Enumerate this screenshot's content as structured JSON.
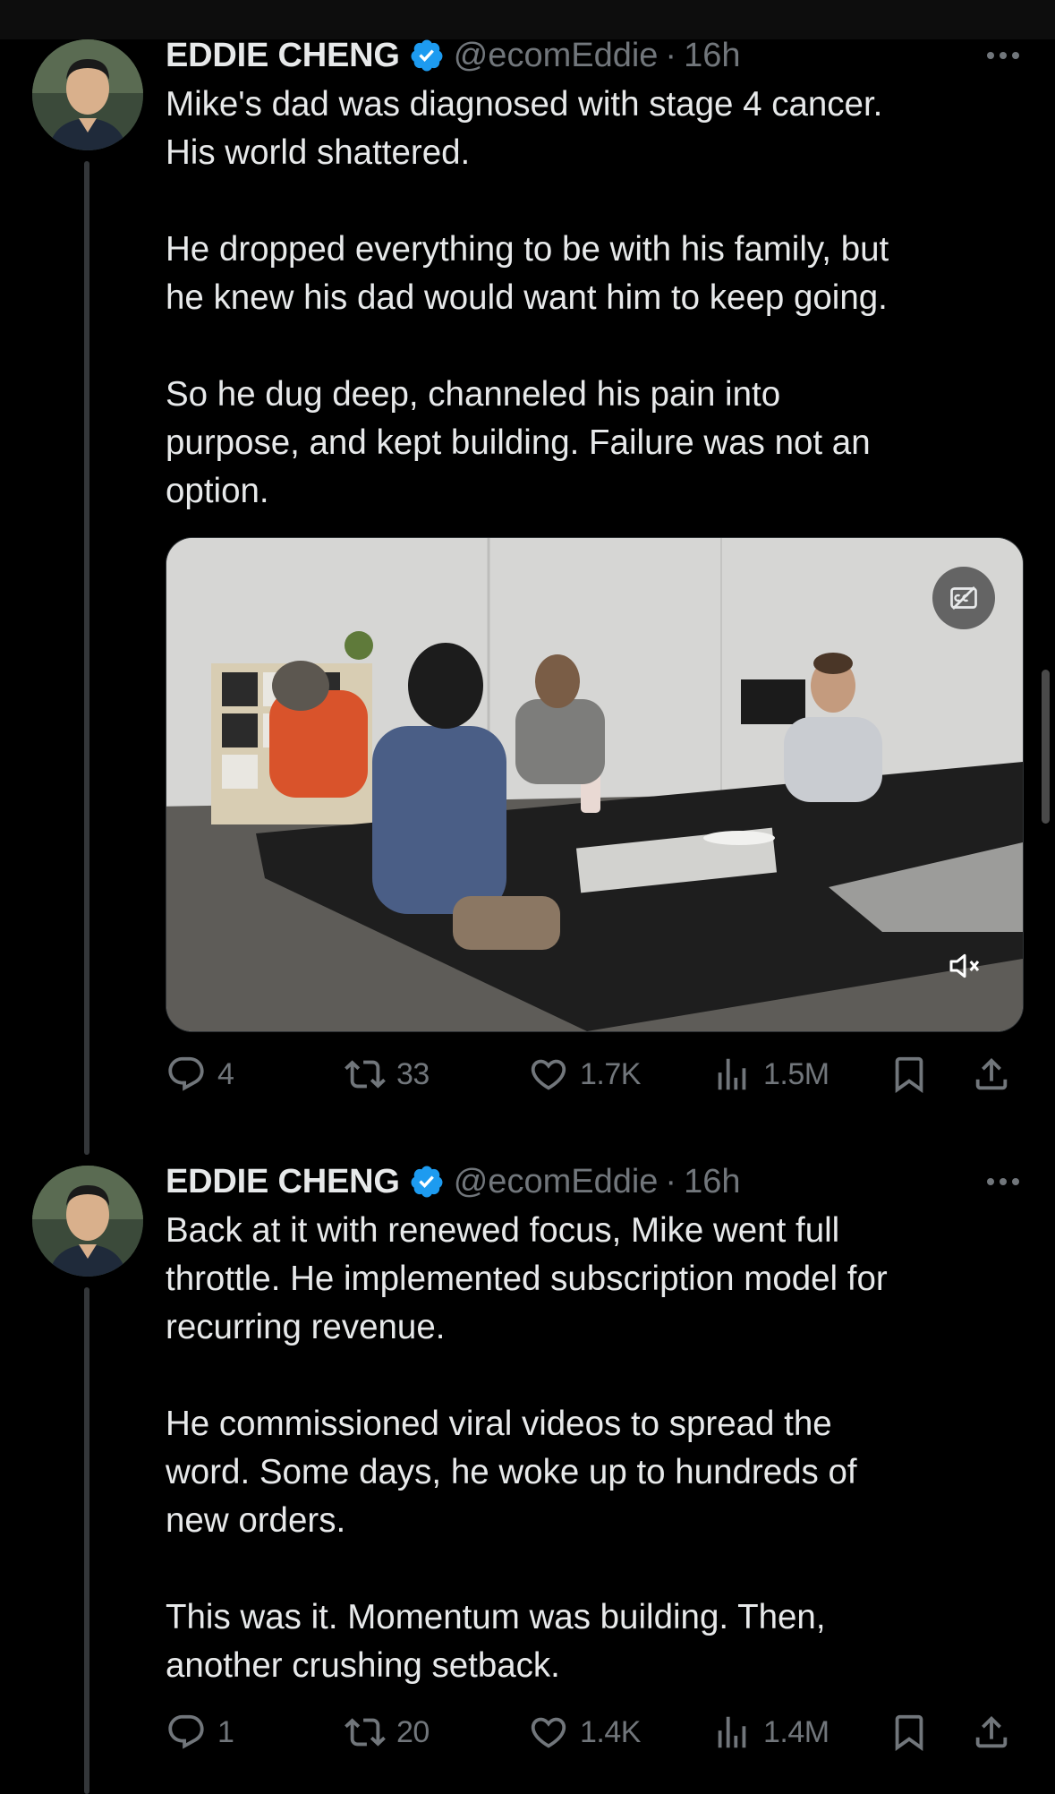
{
  "tweets": [
    {
      "author": "EDDIE CHENG",
      "handle": "@ecomEddie",
      "separator": "·",
      "time": "16h",
      "paragraphs": [
        "Mike's dad was diagnosed with stage 4 cancer.\nHis world shattered.",
        "He dropped everything to be with his family, but\nhe knew his dad would want him to keep going.",
        "So he dug deep, channeled his pain into\npurpose, and kept building. Failure was not an\noption."
      ],
      "replies": "4",
      "reposts": "33",
      "likes": "1.7K",
      "views": "1.5M"
    },
    {
      "author": "EDDIE CHENG",
      "handle": "@ecomEddie",
      "separator": "·",
      "time": "16h",
      "paragraphs": [
        "Back at it with renewed focus, Mike went full\nthrottle. He implemented subscription model for\nrecurring revenue.",
        "He commissioned viral videos to spread the\nword. Some days, he woke up to hundreds of\nnew orders.",
        "This was it. Momentum was building. Then,\nanother crushing setback."
      ],
      "replies": "1",
      "reposts": "20",
      "likes": "1.4K",
      "views": "1.4M"
    }
  ],
  "icons": {
    "verified": "verified-badge-icon",
    "more": "more-options-icon",
    "reply": "reply-icon",
    "repost": "repost-icon",
    "like": "heart-icon",
    "views": "views-icon",
    "bookmark": "bookmark-icon",
    "share": "share-icon",
    "captions": "captions-icon",
    "mute": "muted-speaker-icon"
  },
  "colors": {
    "background": "#000000",
    "text": "#e7e9ea",
    "secondary": "#71767b",
    "verified": "#1d9bf0"
  }
}
